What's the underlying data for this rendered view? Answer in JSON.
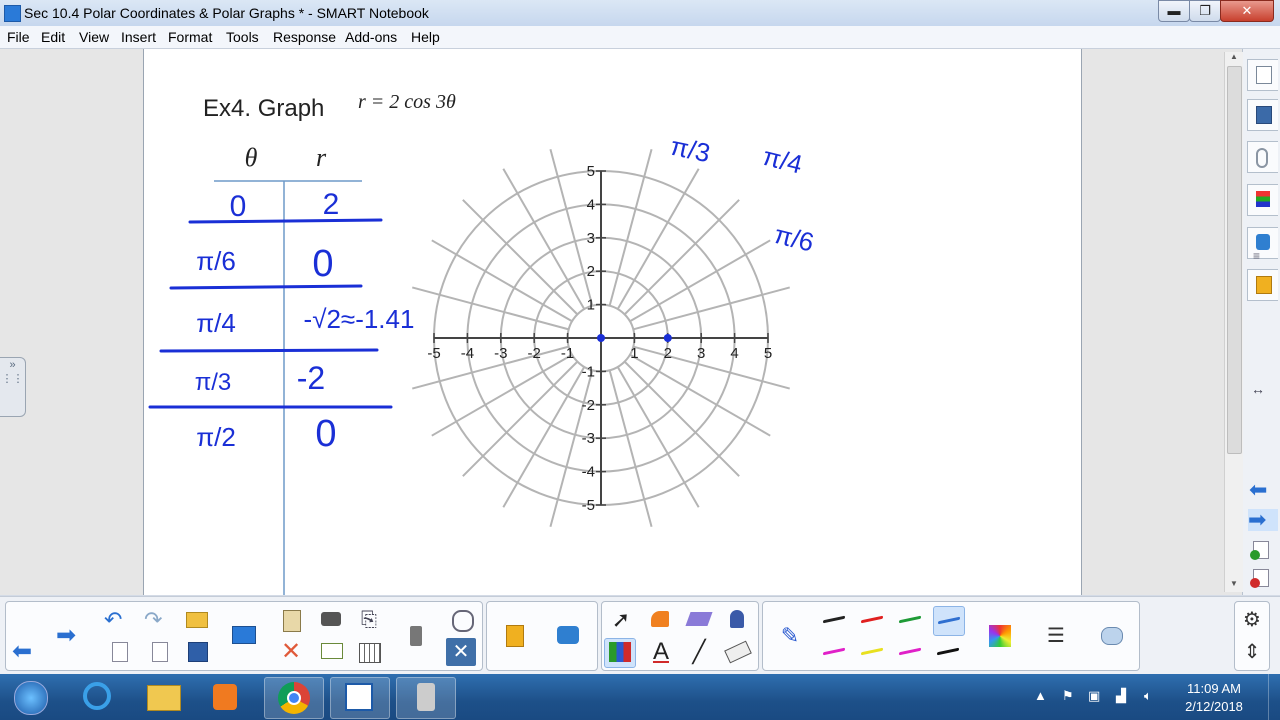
{
  "window": {
    "title": "Sec 10.4 Polar Coordinates & Polar Graphs * - SMART Notebook",
    "min_label": "▬",
    "max_label": "❐",
    "close_label": "✕"
  },
  "menu": [
    "File",
    "Edit",
    "View",
    "Insert",
    "Format",
    "Tools",
    "Response",
    "Add-ons",
    "Help"
  ],
  "page": {
    "heading": "Ex4.  Graph",
    "equation": "r = 2 cos 3θ",
    "table_headers": [
      "θ",
      "r"
    ],
    "table_rows": [
      {
        "theta": "0",
        "r": "2"
      },
      {
        "theta": "π/6",
        "r": "0"
      },
      {
        "theta": "π/4",
        "r": "-√2≈-1.41"
      },
      {
        "theta": "π/3",
        "r": "-2"
      },
      {
        "theta": "π/2",
        "r": "0"
      }
    ],
    "angle_labels": [
      "π/3",
      "π/4",
      "π/6"
    ],
    "polar_grid": {
      "rings": [
        1,
        2,
        3,
        4,
        5
      ],
      "radial_line_step_deg": 15,
      "x_ticks": [
        "-5",
        "-4",
        "-3",
        "-2",
        "-1",
        "1",
        "2",
        "3",
        "4",
        "5"
      ],
      "y_ticks": [
        "5",
        "4",
        "3",
        "2",
        "1",
        "-1",
        "-2",
        "-3",
        "-4",
        "-5"
      ],
      "plotted_points": [
        {
          "r": 0,
          "theta_deg": 0
        },
        {
          "r": 2,
          "theta_deg": 0
        }
      ]
    },
    "ink_color": "#1a2fd6"
  },
  "sidebar": [
    "page-sorter-icon",
    "gallery-icon",
    "attachments-icon",
    "properties-icon",
    "addons-icon",
    "lesson-activity-icon"
  ],
  "toolbar": {
    "pen_colors": [
      "#222222",
      "#e02020",
      "#1e9a36",
      "#2f6fd0",
      "#e020c8",
      "#e8e020",
      "#e020c8",
      "#111111"
    ]
  },
  "taskbar": {
    "time": "11:09 AM",
    "date": "2/12/2018"
  }
}
